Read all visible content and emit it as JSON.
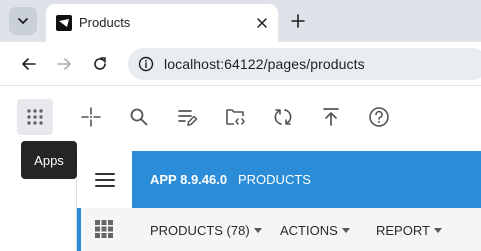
{
  "browser": {
    "tab_title": "Products",
    "url": "localhost:64122/pages/products"
  },
  "toolbar": {
    "buttons": [
      "apps-grid-icon",
      "crosshair-icon",
      "search-icon",
      "edit-list-icon",
      "folder-code-icon",
      "sync-icon",
      "upload-icon",
      "help-icon"
    ],
    "tooltip": "Apps"
  },
  "app": {
    "version": "APP 8.9.46.0",
    "page": "PRODUCTS",
    "accent_color": "#2b8dd8"
  },
  "menu": {
    "items": [
      {
        "label": "PRODUCTS (78)"
      },
      {
        "label": "ACTIONS"
      },
      {
        "label": "REPORT"
      }
    ]
  }
}
